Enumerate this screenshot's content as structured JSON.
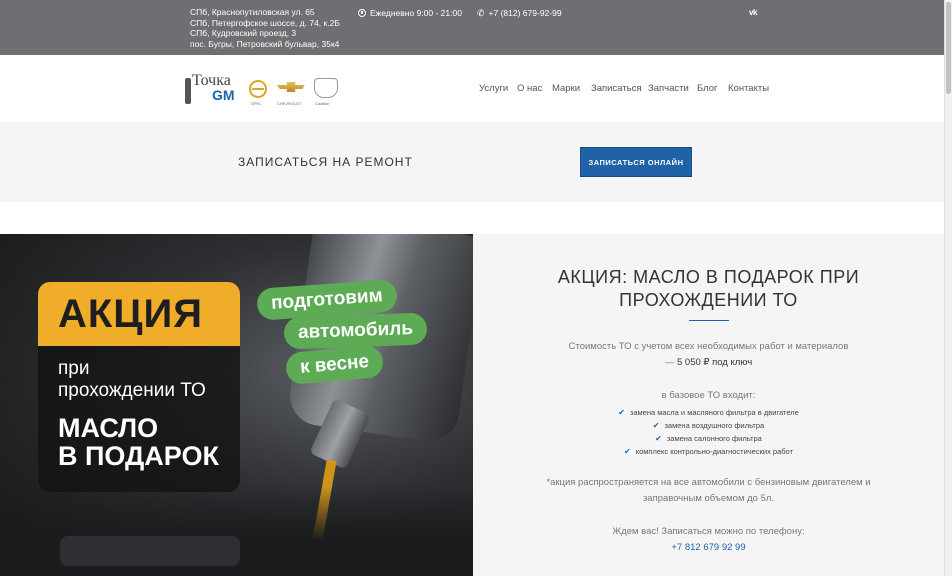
{
  "topbar": {
    "addresses": [
      "СПб, Краснопутиловская ул. 65",
      "СПб, Петергофское шоссе, д. 74, к.2Б",
      "СПб, Кудровский проезд, 3",
      "пос. Бугры, Петровский бульвар, 35к4"
    ],
    "hours": "Ежедневно 9:00 - 21:00",
    "phone": "+7 (812) 679-92-99",
    "social": "vk-icon"
  },
  "header": {
    "logo_word": "Точка",
    "logo_gm": "GM",
    "brands": [
      "OPEL",
      "CHEVROLET",
      "Cadillac"
    ],
    "nav": [
      "Услуги",
      "О нас",
      "Марки",
      "Записаться",
      "Запчасти",
      "Блог",
      "Контакты"
    ]
  },
  "signup": {
    "title": "ЗАПИСАТЬСЯ НА РЕМОНТ",
    "button": "ЗАПИСАТЬСЯ ОНЛАЙН"
  },
  "promo": {
    "badge": "АКЦИЯ",
    "sub_line1": "при",
    "sub_line2": "прохождении ТО",
    "big_line1": "МАСЛО",
    "big_line2": "В ПОДАРОК",
    "pill1": "подготовим",
    "pill2": "автомобиль",
    "pill3": "к весне"
  },
  "info": {
    "title_line1": "АКЦИЯ: МАСЛО В ПОДАРОК ПРИ",
    "title_line2": "ПРОХОЖДЕНИИ ТО",
    "cost_text": "Стоимость ТО с учетом всех необходимых работ и материалов",
    "cost_dash": "—",
    "cost_price": "5 050 ₽ под ключ",
    "includes": "в базовое ТО входит:",
    "items": [
      "замена масла и масляного фильтра в двигателе",
      "замена воздушного фильтра",
      "замена салонного фильтра",
      "комплекс контрольно-диагностических работ"
    ],
    "note_line1": "*акция распространяется на все автомобили с бензиновым двигателем и",
    "note_line2": "заправочным объемом до 5л.",
    "wait": "Ждем вас! Записаться можно по телефону:",
    "tel": "+7 812 679 92 99"
  },
  "colors": {
    "accent": "#1f62a8",
    "topbar": "#6e6f72",
    "promo_yellow": "#f0ad2a",
    "promo_green": "#5eab56"
  }
}
